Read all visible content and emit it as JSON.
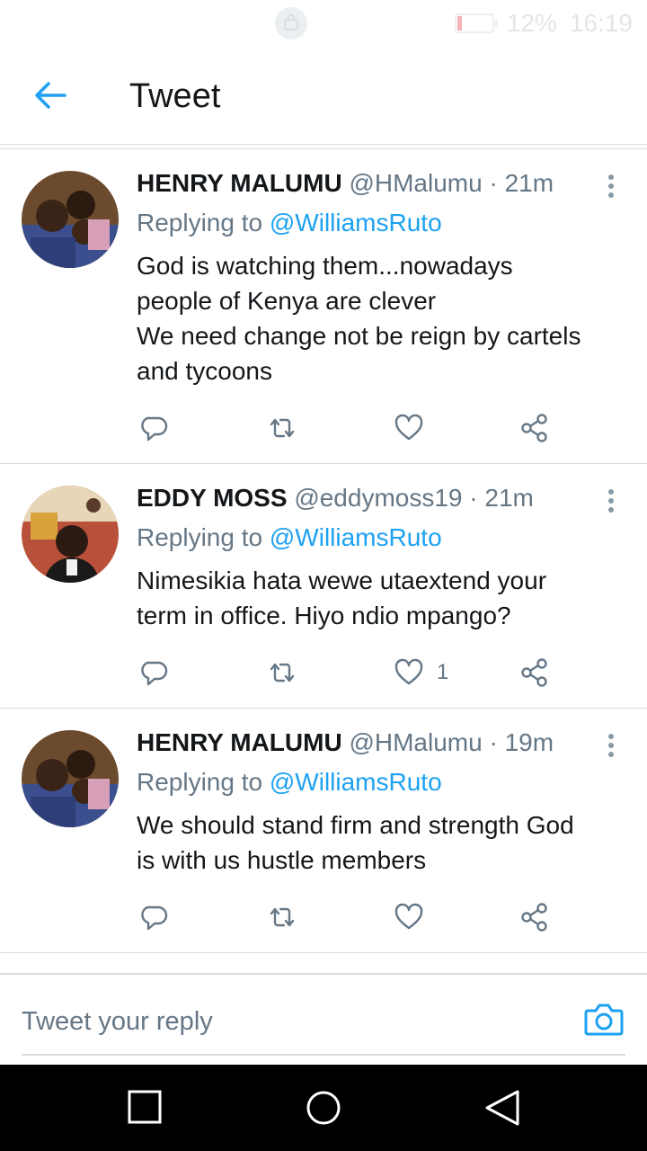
{
  "status_bar": {
    "battery_percent": "12%",
    "time": "16:19",
    "battery_level": 0.12
  },
  "header": {
    "title": "Tweet",
    "back_icon": "arrow-left-icon"
  },
  "tweets": [
    {
      "name": "HENRY MALUMU",
      "handle": "@HMalumu",
      "separator": "·",
      "time": "21m",
      "replying_prefix": "Replying to",
      "replying_to": "@WilliamsRuto",
      "text_lines": [
        "God is watching them...nowadays",
        "people of Kenya are clever",
        "We need change not be reign by cartels",
        "and tycoons"
      ],
      "like_count": ""
    },
    {
      "name": "EDDY MOSS",
      "handle": "@eddymoss19",
      "separator": "·",
      "time": "21m",
      "replying_prefix": "Replying to",
      "replying_to": "@WilliamsRuto",
      "text_lines": [
        "Nimesikia hata wewe utaextend your",
        "term in office. Hiyo ndio mpango?"
      ],
      "like_count": "1"
    },
    {
      "name": "HENRY MALUMU",
      "handle": "@HMalumu",
      "separator": "·",
      "time": "19m",
      "replying_prefix": "Replying to",
      "replying_to": "@WilliamsRuto",
      "text_lines": [
        "We should stand firm and strength God",
        "is with us hustle members"
      ],
      "like_count": ""
    }
  ],
  "reply_bar": {
    "placeholder": "Tweet your reply",
    "camera_icon": "camera-icon"
  },
  "nav_bar": {
    "icons": [
      "recent-apps-icon",
      "home-icon",
      "back-triangle-icon"
    ]
  },
  "colors": {
    "accent": "#1da1f2",
    "secondary_text": "#657786",
    "primary_text": "#14171a",
    "divider": "#d5dbe0"
  }
}
